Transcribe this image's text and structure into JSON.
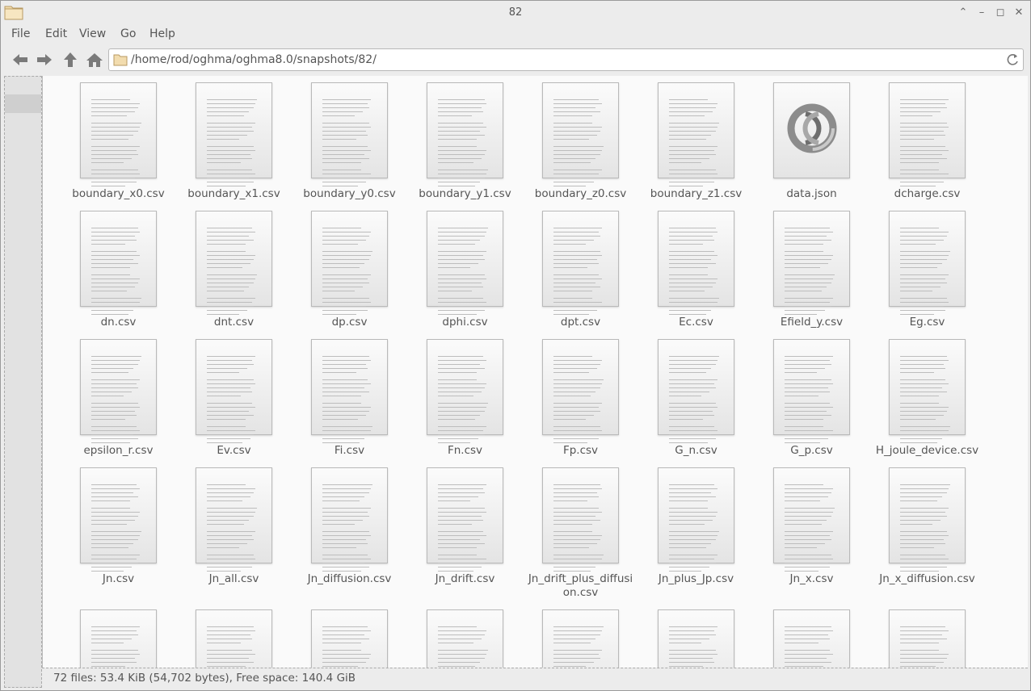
{
  "window": {
    "title": "82",
    "minimize": "⌃",
    "restore_down": "–",
    "maximize": "◻",
    "close": "✕"
  },
  "menubar": [
    "File",
    "Edit",
    "View",
    "Go",
    "Help"
  ],
  "toolbar": {
    "location": "/home/rod/oghma/oghma8.0/snapshots/82/"
  },
  "files": [
    {
      "name": "boundary_x0.csv",
      "type": "text"
    },
    {
      "name": "boundary_x1.csv",
      "type": "text"
    },
    {
      "name": "boundary_y0.csv",
      "type": "text"
    },
    {
      "name": "boundary_y1.csv",
      "type": "text"
    },
    {
      "name": "boundary_z0.csv",
      "type": "text"
    },
    {
      "name": "boundary_z1.csv",
      "type": "text"
    },
    {
      "name": "data.json",
      "type": "json"
    },
    {
      "name": "dcharge.csv",
      "type": "text"
    },
    {
      "name": "dn.csv",
      "type": "text"
    },
    {
      "name": "dnt.csv",
      "type": "text"
    },
    {
      "name": "dp.csv",
      "type": "text"
    },
    {
      "name": "dphi.csv",
      "type": "text"
    },
    {
      "name": "dpt.csv",
      "type": "text"
    },
    {
      "name": "Ec.csv",
      "type": "text"
    },
    {
      "name": "Efield_y.csv",
      "type": "text"
    },
    {
      "name": "Eg.csv",
      "type": "text"
    },
    {
      "name": "epsilon_r.csv",
      "type": "text"
    },
    {
      "name": "Ev.csv",
      "type": "text"
    },
    {
      "name": "Fi.csv",
      "type": "text"
    },
    {
      "name": "Fn.csv",
      "type": "text"
    },
    {
      "name": "Fp.csv",
      "type": "text"
    },
    {
      "name": "G_n.csv",
      "type": "text"
    },
    {
      "name": "G_p.csv",
      "type": "text"
    },
    {
      "name": "H_joule_device.csv",
      "type": "text"
    },
    {
      "name": "Jn.csv",
      "type": "text"
    },
    {
      "name": "Jn_all.csv",
      "type": "text"
    },
    {
      "name": "Jn_diffusion.csv",
      "type": "text"
    },
    {
      "name": "Jn_drift.csv",
      "type": "text"
    },
    {
      "name": "Jn_drift_plus_diffusi\non.csv",
      "type": "text"
    },
    {
      "name": "Jn_plus_Jp.csv",
      "type": "text"
    },
    {
      "name": "Jn_x.csv",
      "type": "text"
    },
    {
      "name": "Jn_x_diffusion.csv",
      "type": "text"
    },
    {
      "name": "",
      "type": "text"
    },
    {
      "name": "",
      "type": "text"
    },
    {
      "name": "",
      "type": "text"
    },
    {
      "name": "",
      "type": "text"
    },
    {
      "name": "",
      "type": "text"
    },
    {
      "name": "",
      "type": "text"
    },
    {
      "name": "",
      "type": "text"
    },
    {
      "name": "",
      "type": "text"
    }
  ],
  "statusbar": {
    "text": "72 files: 53.4 KiB (54,702 bytes), Free space: 140.4 GiB"
  }
}
